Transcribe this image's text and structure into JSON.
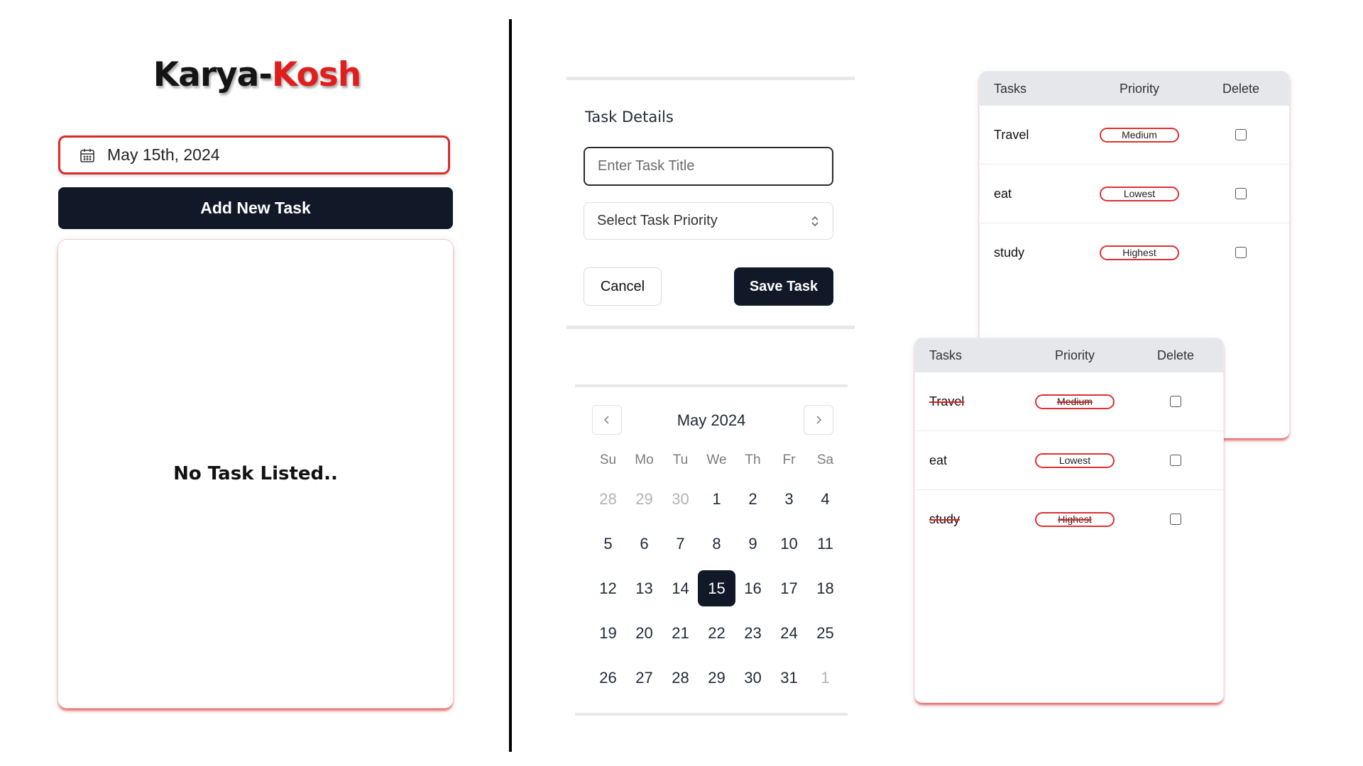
{
  "brand": {
    "part1": "Karya-",
    "part2": "Kosh"
  },
  "date_field": {
    "value": "May 15th, 2024"
  },
  "add_button": {
    "label": "Add New Task"
  },
  "task_list": {
    "empty_text": "No Task Listed.."
  },
  "form": {
    "title": "Task Details",
    "title_placeholder": "Enter Task Title",
    "priority_placeholder": "Select Task Priority",
    "cancel_label": "Cancel",
    "save_label": "Save Task"
  },
  "calendar": {
    "caption": "May 2024",
    "weekdays": [
      "Su",
      "Mo",
      "Tu",
      "We",
      "Th",
      "Fr",
      "Sa"
    ],
    "selected_day": "15",
    "days": [
      {
        "d": "28",
        "outside": true
      },
      {
        "d": "29",
        "outside": true
      },
      {
        "d": "30",
        "outside": true
      },
      {
        "d": "1"
      },
      {
        "d": "2"
      },
      {
        "d": "3"
      },
      {
        "d": "4"
      },
      {
        "d": "5"
      },
      {
        "d": "6"
      },
      {
        "d": "7"
      },
      {
        "d": "8"
      },
      {
        "d": "9"
      },
      {
        "d": "10"
      },
      {
        "d": "11"
      },
      {
        "d": "12"
      },
      {
        "d": "13"
      },
      {
        "d": "14"
      },
      {
        "d": "15"
      },
      {
        "d": "16"
      },
      {
        "d": "17"
      },
      {
        "d": "18"
      },
      {
        "d": "19"
      },
      {
        "d": "20"
      },
      {
        "d": "21"
      },
      {
        "d": "22"
      },
      {
        "d": "23"
      },
      {
        "d": "24"
      },
      {
        "d": "25"
      },
      {
        "d": "26"
      },
      {
        "d": "27"
      },
      {
        "d": "28"
      },
      {
        "d": "29"
      },
      {
        "d": "30"
      },
      {
        "d": "31"
      },
      {
        "d": "1",
        "outside": true
      }
    ]
  },
  "tables": [
    {
      "headers": [
        "Tasks",
        "Priority",
        "Delete"
      ],
      "rows": [
        {
          "task": "Travel",
          "priority": "Medium",
          "done": false
        },
        {
          "task": "eat",
          "priority": "Lowest",
          "done": false
        },
        {
          "task": "study",
          "priority": "Highest",
          "done": false
        }
      ]
    },
    {
      "headers": [
        "Tasks",
        "Priority",
        "Delete"
      ],
      "rows": [
        {
          "task": "Travel",
          "priority": "Medium",
          "done": true
        },
        {
          "task": "eat",
          "priority": "Lowest",
          "done": false
        },
        {
          "task": "study",
          "priority": "Highest",
          "done": true
        }
      ]
    }
  ],
  "colors": {
    "accent": "#e01e1e",
    "dark": "#111827",
    "header_bg": "#e5e7eb"
  }
}
